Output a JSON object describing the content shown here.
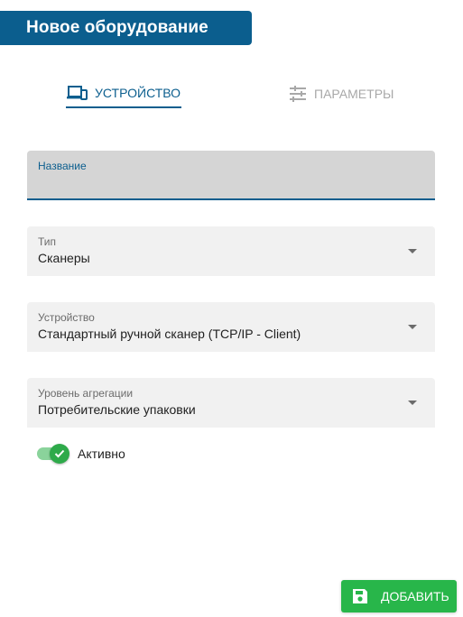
{
  "header": {
    "title": "Новое оборудование"
  },
  "tabs": [
    {
      "label": "УСТРОЙСТВО",
      "icon": "devices-icon",
      "active": true,
      "color": "#0b5e8e"
    },
    {
      "label": "ПАРАМЕТРЫ",
      "icon": "tune-icon",
      "active": false,
      "color": "#a8a8a8"
    }
  ],
  "form": {
    "name": {
      "label": "Название",
      "value": ""
    },
    "type": {
      "label": "Тип",
      "value": "Сканеры"
    },
    "device": {
      "label": "Устройство",
      "value": "Стандартный ручной сканер (TCP/IP - Client)"
    },
    "aggregation": {
      "label": "Уровень агрегации",
      "value": "Потребительские упаковки"
    },
    "active": {
      "label": "Активно",
      "checked": true
    }
  },
  "actions": {
    "add_label": "ДОБАВИТЬ",
    "add_icon": "save-icon"
  },
  "colors": {
    "primary": "#0b5e8e",
    "success": "#28b64a",
    "field_bg": "#f1f1f1"
  }
}
